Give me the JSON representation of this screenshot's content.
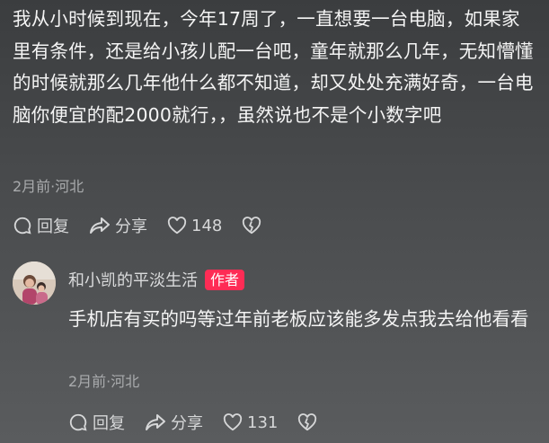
{
  "main_comment": {
    "text": "我从小时候到现在，今年17周了，一直想要一台电脑，如果家里有条件，还是给小孩儿配一台吧，童年就那么几年，无知懵懂的时候就那么几年他什么都不知道，却又处处充满好奇，一台电脑你便宜的配2000就行，，虽然说也不是个小数字吧",
    "meta": "2月前·河北",
    "reply_label": "回复",
    "share_label": "分享",
    "like_count": "148"
  },
  "reply": {
    "author": "和小凯的平淡生活",
    "badge": "作者",
    "text": "手机店有买的吗等过年前老板应该能多发点我去给他看看",
    "meta": "2月前·河北",
    "reply_label": "回复",
    "share_label": "分享",
    "like_count": "131"
  },
  "icons": {
    "reply": "comment-bubble-icon",
    "share": "share-arrow-icon",
    "like": "heart-icon",
    "dislike": "broken-heart-icon"
  },
  "colors": {
    "badge": "#fe2c55",
    "meta_text": "#a9abad"
  }
}
